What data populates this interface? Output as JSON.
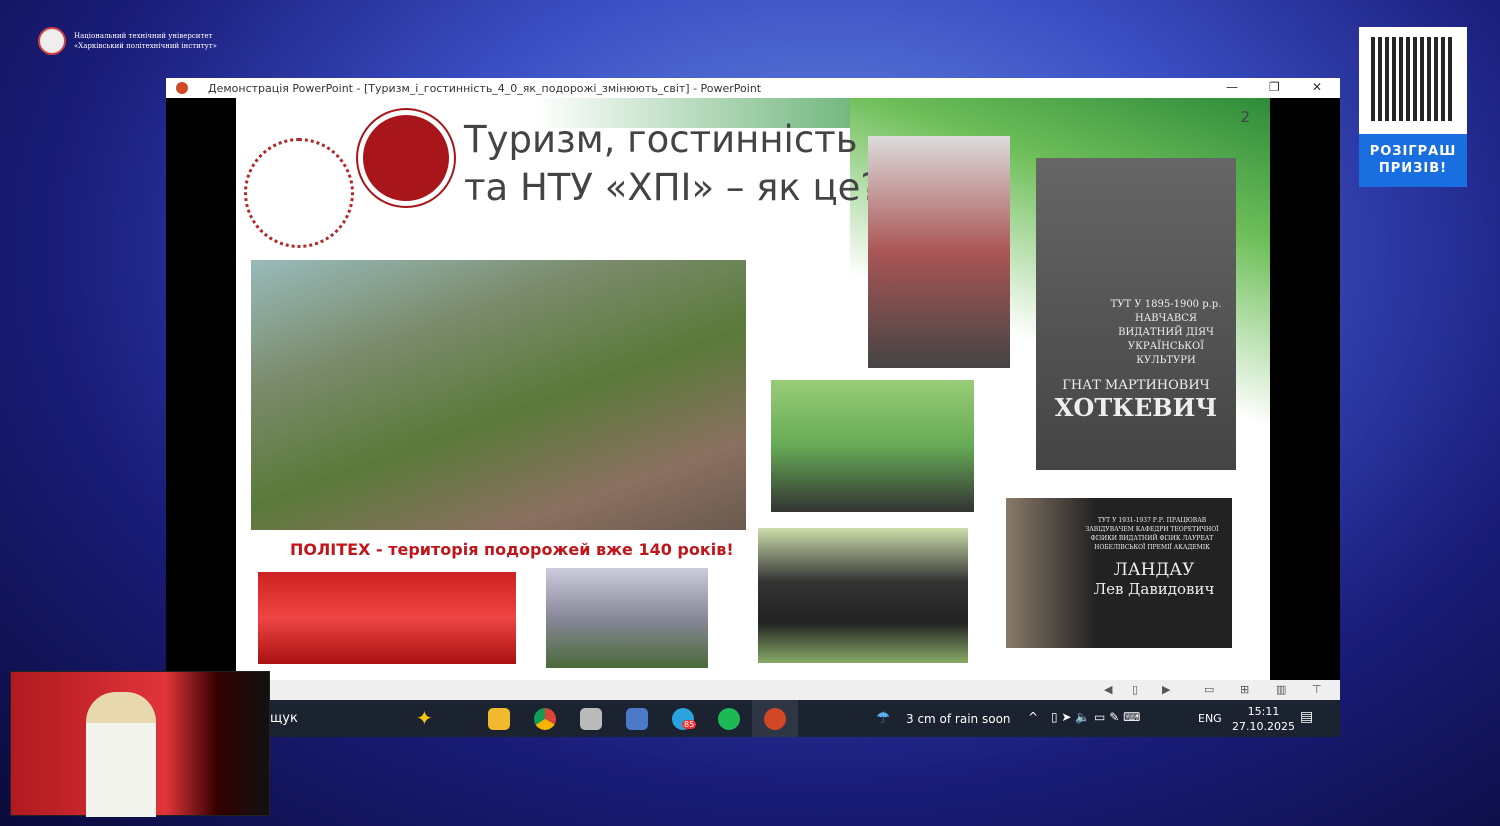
{
  "brand": {
    "line1": "Національний технічний університет",
    "line2": "«Харківський політехнічний інститут»"
  },
  "qr": {
    "button": "РОЗІГРАШ ПРИЗІВ!"
  },
  "window": {
    "title": "Демонстрація PowerPoint - [Туризм_і_гостинність_4_0_як_подорожі_змінюють_світ] - PowerPoint",
    "minimize": "—",
    "restore": "❐",
    "close": "✕"
  },
  "slide": {
    "title_line1": "Туризм, гостинність",
    "title_line2": "та НТУ «ХПІ» – як це?",
    "page_number": "2",
    "caption": "ПОЛІТЕХ - територія подорожей вже 140 років!",
    "plaque1": {
      "small": "ТУТ У 1895-1900 р.р. НАВЧАВСЯ ВИДАТНИЙ ДІЯЧ УКРАЇНСЬКОЇ КУЛЬТУРИ",
      "name1": "ГНАТ МАРТИНОВИЧ",
      "name2": "ХОТКЕВИЧ"
    },
    "plaque2": {
      "small": "ТУТ У 1931-1937 Р.Р. ПРАЦЮВАВ ЗАВІДУВАЧЕМ КАФЕДРИ ТЕОРЕТИЧНОЇ ФІЗИКИ ВИДАТНИЙ ФІЗИК ЛАУРЕАТ НОБЕЛІВСЬКОЇ ПРЕМІЇ АКАДЕМІК",
      "name1": "ЛАНДАУ",
      "name2": "Лев Давидович"
    }
  },
  "taskbar": {
    "search": "щук",
    "weather": "3 cm of rain soon",
    "lang": "ENG",
    "time": "15:11",
    "date": "27.10.2025",
    "telegram_badge": "85"
  }
}
